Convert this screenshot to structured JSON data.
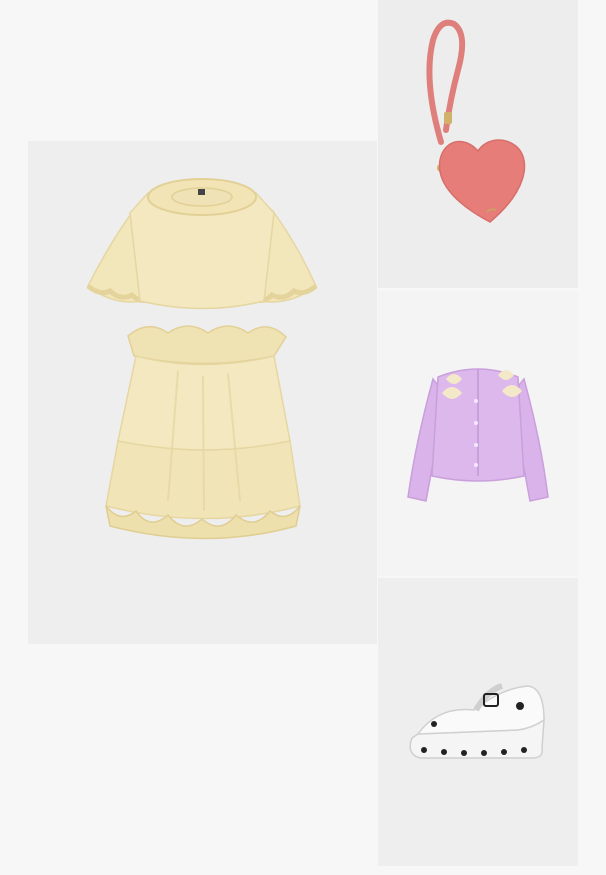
{
  "products": [
    {
      "id": "dress",
      "icon": "ruffle-dress-image"
    },
    {
      "id": "bag",
      "icon": "heart-bag-image"
    },
    {
      "id": "sweater",
      "icon": "bow-cardigan-image"
    },
    {
      "id": "shoe",
      "icon": "mary-jane-shoe-image"
    }
  ],
  "colors": {
    "page_bg": "#f7f7f7",
    "dress": "#f3e8bf",
    "bag": "#e37c7a",
    "cardigan": "#d9b3ea",
    "shoe": "#f5f5f5"
  }
}
